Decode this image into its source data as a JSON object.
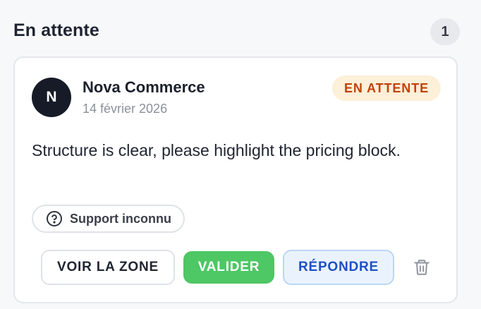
{
  "section": {
    "title": "En attente",
    "count": "1"
  },
  "comment": {
    "avatar_initial": "N",
    "author": "Nova Commerce",
    "date": "14 février 2026",
    "status": "EN ATTENTE",
    "text": "Structure is clear, please highlight the pricing block.",
    "support_label": "Support inconnu",
    "support_icon": "question-circle-icon"
  },
  "actions": {
    "view_zone_label": "VOIR LA ZONE",
    "validate_label": "VALIDER",
    "reply_label": "RÉPONDRE",
    "delete_icon": "trash-icon"
  },
  "colors": {
    "status_bg": "#fdf0d8",
    "status_text": "#c2410c",
    "validate_bg": "#4ec765",
    "reply_bg": "#eaf3fd",
    "reply_text": "#1d4fc7",
    "avatar_bg": "#161b27"
  }
}
